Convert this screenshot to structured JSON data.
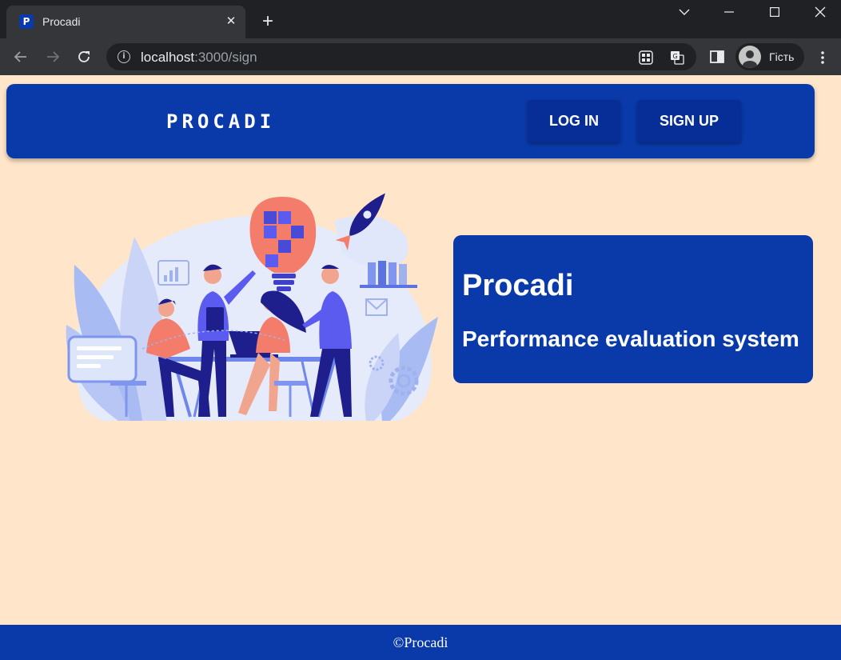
{
  "browser": {
    "tab": {
      "favicon_letter": "P",
      "title": "Procadi",
      "close_symbol": "✕"
    },
    "new_tab_symbol": "+",
    "address": {
      "host": "localhost",
      "port_path": ":3000/sign"
    },
    "profile": {
      "label": "Гість"
    }
  },
  "app": {
    "brand": "PROCADI",
    "nav": {
      "login_label": "LOG IN",
      "signup_label": "SIGN UP"
    },
    "hero": {
      "title": "Procadi",
      "subtitle": "Performance evaluation system"
    },
    "footer_text": "©Procadi"
  },
  "icons": {
    "back": "arrow-left-icon",
    "forward": "arrow-right-icon",
    "reload": "reload-icon",
    "info": "info-icon",
    "apps": "apps-grid-icon",
    "translate": "translate-icon",
    "side_panel": "side-panel-icon",
    "avatar": "user-avatar-icon",
    "menu": "kebab-menu-icon"
  },
  "colors": {
    "primary": "#0a3aa9",
    "page_background": "#ffe5c9",
    "chrome_dark": "#202124",
    "chrome_toolbar": "#35363a"
  }
}
